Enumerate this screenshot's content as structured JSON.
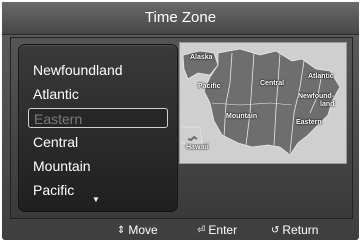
{
  "title": "Time Zone",
  "zones": [
    {
      "label": "Newfoundland",
      "selected": false
    },
    {
      "label": "Atlantic",
      "selected": false
    },
    {
      "label": "Eastern",
      "selected": true
    },
    {
      "label": "Central",
      "selected": false
    },
    {
      "label": "Mountain",
      "selected": false
    },
    {
      "label": "Pacific",
      "selected": false
    }
  ],
  "scroll_indicator": "▼",
  "map": {
    "labels": {
      "alaska": "Alaska",
      "pacific": "Pacific",
      "central": "Central",
      "atlantic": "Atlantic",
      "newfoundland_1": "Newfound-",
      "newfoundland_2": "land",
      "mountain": "Mountain",
      "eastern": "Eastern",
      "hawaii": "Hawaii"
    }
  },
  "footer": {
    "move_icon": "updown-arrows-icon",
    "move": "Move",
    "enter_icon": "enter-icon",
    "enter": "Enter",
    "return_icon": "return-icon",
    "return": "Return"
  }
}
